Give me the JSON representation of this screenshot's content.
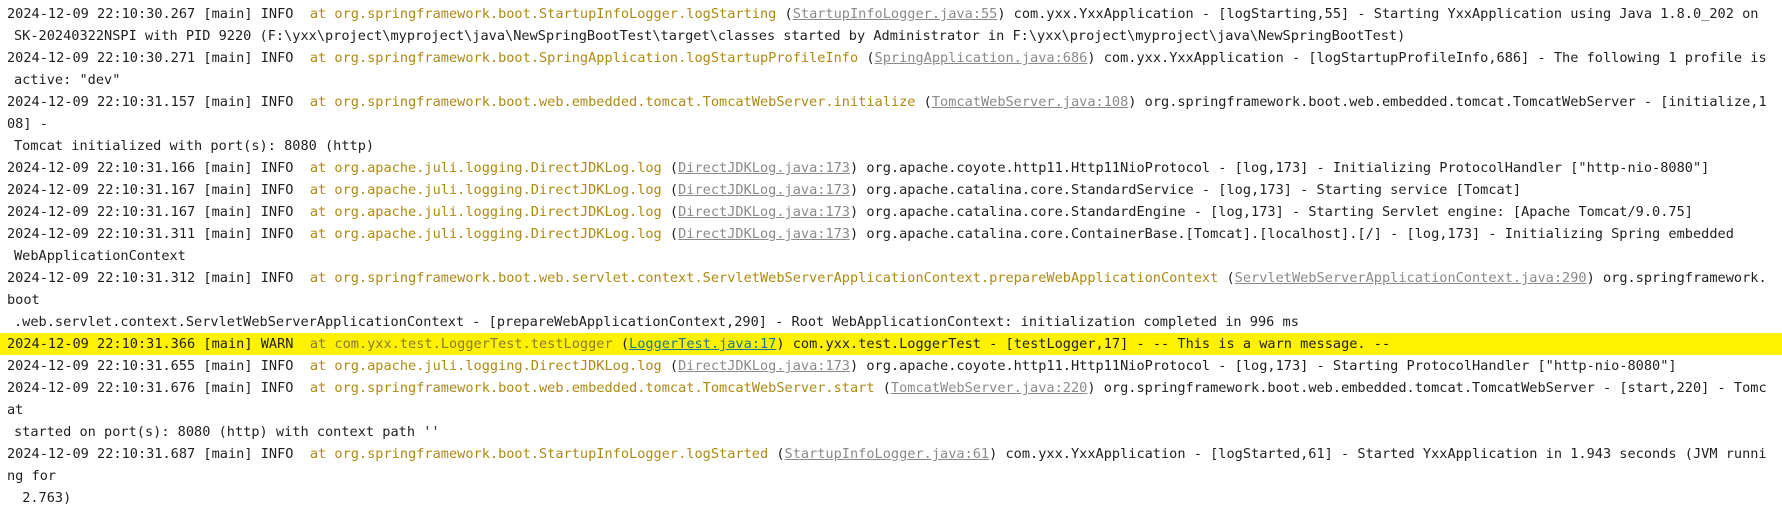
{
  "colors": {
    "text": "#1f1f1f",
    "method_ref": "#ad8a12",
    "source_link": "#8a8a8a",
    "warn_highlight": "#fff200",
    "warn_link": "#1a7a8c"
  },
  "log_lines": [
    {
      "prefix": "2024-12-09 22:10:30.267 [main] INFO  ",
      "at": "at org.springframework.boot.StartupInfoLogger.logStarting",
      "link": "StartupInfoLogger.java:55",
      "msg": " com.yxx.YxxApplication - [logStarting,55] - Starting YxxApplication using Java 1.8.0_202 on",
      "cont": "SK-20240322NSPI with PID 9220 (F:\\yxx\\project\\myproject\\java\\NewSpringBootTest\\target\\classes started by Administrator in F:\\yxx\\project\\myproject\\java\\NewSpringBootTest)",
      "level": "INFO"
    },
    {
      "prefix": "2024-12-09 22:10:30.271 [main] INFO  ",
      "at": "at org.springframework.boot.SpringApplication.logStartupProfileInfo",
      "link": "SpringApplication.java:686",
      "msg": " com.yxx.YxxApplication - [logStartupProfileInfo,686] - The following 1 profile is",
      "cont": "active: \"dev\"",
      "level": "INFO"
    },
    {
      "prefix": "2024-12-09 22:10:31.157 [main] INFO  ",
      "at": "at org.springframework.boot.web.embedded.tomcat.TomcatWebServer.initialize",
      "link": "TomcatWebServer.java:108",
      "msg": " org.springframework.boot.web.embedded.tomcat.TomcatWebServer - [initialize,108] -",
      "cont": "Tomcat initialized with port(s): 8080 (http)",
      "level": "INFO"
    },
    {
      "prefix": "2024-12-09 22:10:31.166 [main] INFO  ",
      "at": "at org.apache.juli.logging.DirectJDKLog.log",
      "link": "DirectJDKLog.java:173",
      "msg": " org.apache.coyote.http11.Http11NioProtocol - [log,173] - Initializing ProtocolHandler [\"http-nio-8080\"]",
      "cont": "",
      "level": "INFO"
    },
    {
      "prefix": "2024-12-09 22:10:31.167 [main] INFO  ",
      "at": "at org.apache.juli.logging.DirectJDKLog.log",
      "link": "DirectJDKLog.java:173",
      "msg": " org.apache.catalina.core.StandardService - [log,173] - Starting service [Tomcat]",
      "cont": "",
      "level": "INFO"
    },
    {
      "prefix": "2024-12-09 22:10:31.167 [main] INFO  ",
      "at": "at org.apache.juli.logging.DirectJDKLog.log",
      "link": "DirectJDKLog.java:173",
      "msg": " org.apache.catalina.core.StandardEngine - [log,173] - Starting Servlet engine: [Apache Tomcat/9.0.75]",
      "cont": "",
      "level": "INFO"
    },
    {
      "prefix": "2024-12-09 22:10:31.311 [main] INFO  ",
      "at": "at org.apache.juli.logging.DirectJDKLog.log",
      "link": "DirectJDKLog.java:173",
      "msg": " org.apache.catalina.core.ContainerBase.[Tomcat].[localhost].[/] - [log,173] - Initializing Spring embedded",
      "cont": "WebApplicationContext",
      "level": "INFO"
    },
    {
      "prefix": "2024-12-09 22:10:31.312 [main] INFO  ",
      "at": "at org.springframework.boot.web.servlet.context.ServletWebServerApplicationContext.prepareWebApplicationContext",
      "link": "ServletWebServerApplicationContext.java:290",
      "msg": " org.springframework.boot",
      "cont": ".web.servlet.context.ServletWebServerApplicationContext - [prepareWebApplicationContext,290] - Root WebApplicationContext: initialization completed in 996 ms",
      "level": "INFO"
    },
    {
      "prefix": "2024-12-09 22:10:31.366 [main] WARN  ",
      "at": "at com.yxx.test.LoggerTest.testLogger",
      "link": "LoggerTest.java:17",
      "msg": " com.yxx.test.LoggerTest - [testLogger,17] - -- This is a warn message. --",
      "cont": "",
      "level": "WARN"
    },
    {
      "prefix": "2024-12-09 22:10:31.655 [main] INFO  ",
      "at": "at org.apache.juli.logging.DirectJDKLog.log",
      "link": "DirectJDKLog.java:173",
      "msg": " org.apache.coyote.http11.Http11NioProtocol - [log,173] - Starting ProtocolHandler [\"http-nio-8080\"]",
      "cont": "",
      "level": "INFO"
    },
    {
      "prefix": "2024-12-09 22:10:31.676 [main] INFO  ",
      "at": "at org.springframework.boot.web.embedded.tomcat.TomcatWebServer.start",
      "link": "TomcatWebServer.java:220",
      "msg": " org.springframework.boot.web.embedded.tomcat.TomcatWebServer - [start,220] - Tomcat",
      "cont": "started on port(s): 8080 (http) with context path ''",
      "level": "INFO"
    },
    {
      "prefix": "2024-12-09 22:10:31.687 [main] INFO  ",
      "at": "at org.springframework.boot.StartupInfoLogger.logStarted",
      "link": "StartupInfoLogger.java:61",
      "msg": " com.yxx.YxxApplication - [logStarted,61] - Started YxxApplication in 1.943 seconds (JVM running for",
      "cont": " 2.763)",
      "level": "INFO"
    }
  ]
}
